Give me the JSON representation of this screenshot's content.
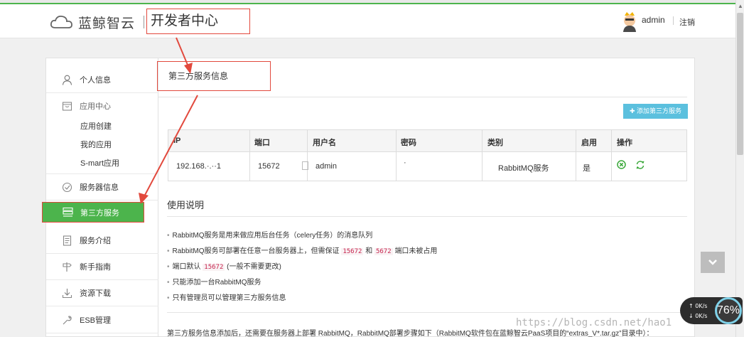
{
  "header": {
    "brand": "蓝鲸智云",
    "subtitle": "开发者中心",
    "user_name": "admin",
    "logout": "注销"
  },
  "sidebar": {
    "items": [
      {
        "label": "个人信息",
        "icon": "user-icon"
      },
      {
        "group": "应用中心",
        "icon": "box-icon",
        "subitems": [
          "应用创建",
          "我的应用",
          "S-mart应用"
        ]
      },
      {
        "label": "服务器信息",
        "icon": "check-circle-icon"
      },
      {
        "label": "第三方服务",
        "icon": "server-icon",
        "active": true
      },
      {
        "label": "服务介绍",
        "icon": "document-icon"
      },
      {
        "label": "新手指南",
        "icon": "signpost-icon"
      },
      {
        "label": "资源下载",
        "icon": "download-icon"
      },
      {
        "label": "ESB管理",
        "icon": "wrench-icon"
      }
    ]
  },
  "main": {
    "title": "第三方服务信息",
    "add_button": "添加第三方服务",
    "table": {
      "columns": [
        "IP",
        "端口",
        "用户名",
        "密码",
        "类别",
        "启用",
        "操作"
      ],
      "rows": [
        {
          "ip": "192.168.·.··1",
          "port": "15672",
          "username": "admin",
          "password": "·",
          "category": "RabbitMQ服务",
          "enabled": "是"
        }
      ]
    },
    "usage_title": "使用说明",
    "usage": [
      {
        "text": "RabbitMQ服务是用来做应用后台任务（celery任务）的消息队列"
      },
      {
        "text_a": "RabbitMQ服务可部署在任意一台服务器上，但需保证",
        "code_a": "15672",
        "text_b": "和",
        "code_b": "5672",
        "text_c": "端口未被占用"
      },
      {
        "text_a": "端口默认",
        "code_a": "15672",
        "text_b": "(一般不需要更改)"
      },
      {
        "text": "只能添加一台RabbitMQ服务"
      },
      {
        "text": "只有管理员可以管理第三方服务信息"
      }
    ],
    "bottom_note": "第三方服务信息添加后，还需要在服务器上部署 RabbitMQ，RabbitMQ部署步骤如下（RabbitMQ软件包在蓝鲸智云PaaS项目的“extras_V*.tar.gz”目录中）："
  },
  "widget": {
    "up_speed": "0K/s",
    "down_speed": "0K/s",
    "percent": "76%"
  },
  "watermark": "https://blog.csdn.net/hao1",
  "colors": {
    "accent_green": "#4cb44c",
    "annotation_red": "#e2493d",
    "button_blue": "#5bc0de"
  }
}
